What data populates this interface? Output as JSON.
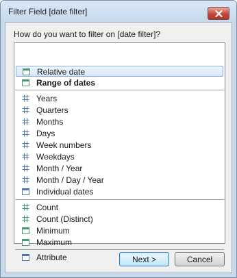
{
  "window": {
    "title": "Filter Field [date filter]"
  },
  "prompt": "How do you want to filter on [date filter]?",
  "list": {
    "group_dates": [
      {
        "label": "Relative date",
        "icon": "calendar-icon",
        "selected": true,
        "bold": false
      },
      {
        "label": "Range of dates",
        "icon": "calendar-icon",
        "selected": false,
        "bold": true
      }
    ],
    "group_parts": [
      {
        "label": "Years",
        "icon": "discrete-hash-icon"
      },
      {
        "label": "Quarters",
        "icon": "discrete-hash-icon"
      },
      {
        "label": "Months",
        "icon": "discrete-hash-icon"
      },
      {
        "label": "Days",
        "icon": "discrete-hash-icon"
      },
      {
        "label": "Week numbers",
        "icon": "discrete-hash-icon"
      },
      {
        "label": "Weekdays",
        "icon": "discrete-hash-icon"
      },
      {
        "label": "Month / Year",
        "icon": "discrete-hash-icon"
      },
      {
        "label": "Month / Day / Year",
        "icon": "discrete-hash-icon"
      },
      {
        "label": "Individual dates",
        "icon": "calendar-icon"
      }
    ],
    "group_measures": [
      {
        "label": "Count",
        "icon": "continuous-hash-icon"
      },
      {
        "label": "Count (Distinct)",
        "icon": "continuous-hash-icon"
      },
      {
        "label": "Minimum",
        "icon": "calendar-icon"
      },
      {
        "label": "Maximum",
        "icon": "calendar-icon"
      }
    ],
    "group_attribute": [
      {
        "label": "Attribute",
        "icon": "calendar-icon"
      }
    ]
  },
  "buttons": {
    "next": "Next >",
    "cancel": "Cancel"
  },
  "colors": {
    "calendar_green": "#4a9a72",
    "calendar_blue": "#4d78b8",
    "hash_blue": "#4d78b8",
    "hash_green": "#3f9a70",
    "selection_border": "#84acdd"
  }
}
